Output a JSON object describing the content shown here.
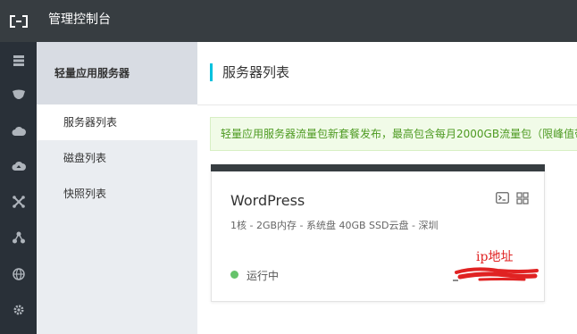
{
  "topbar": {
    "title": "管理控制台"
  },
  "icons": {
    "logo": "aliyun-logo-icon",
    "iconbar": [
      "servers-icon",
      "shield-icon",
      "cloud-icon",
      "cloud-up-icon",
      "network-icon",
      "nodes-icon",
      "globe-icon",
      "gear-icon"
    ],
    "card": [
      "terminal-icon",
      "grid-icon"
    ]
  },
  "sidebar": {
    "title": "轻量应用服务器",
    "items": [
      {
        "label": "服务器列表",
        "active": true
      },
      {
        "label": "磁盘列表",
        "active": false
      },
      {
        "label": "快照列表",
        "active": false
      }
    ]
  },
  "main": {
    "title": "服务器列表",
    "notice": "轻量应用服务器流量包新套餐发布，最高包含每月2000GB流量包（限峰值带",
    "card": {
      "name": "WordPress",
      "spec": "1核 - 2GB内存 - 系统盘 40GB SSD云盘 - 深圳",
      "status": "运行中",
      "ip_annotation": "ip地址"
    }
  },
  "colors": {
    "topbar": "#373d41",
    "iconbar": "#293038",
    "accent": "#00c1de",
    "notice_text": "#4d9a21",
    "status_running": "#66c36b",
    "annotation": "#e02222"
  }
}
